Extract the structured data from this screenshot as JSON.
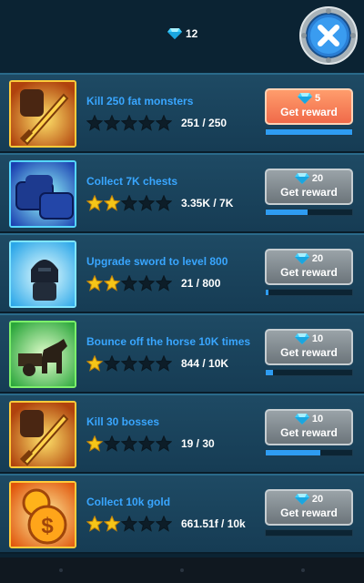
{
  "header": {
    "gem_count": "12"
  },
  "colors": {
    "title": "#39a6ff",
    "bar_fill": "#2e9cf2",
    "star": "#f5c518"
  },
  "quests": [
    {
      "title": "Kill 250 fat monsters",
      "stars_filled": 0,
      "progress": "251 / 250",
      "reward": "5",
      "button_label": "Get reward",
      "highlight": true,
      "bar_fraction": 1.0,
      "icon": "sword-icon"
    },
    {
      "title": "Collect 7K chests",
      "stars_filled": 2,
      "progress": "3.35K / 7K",
      "reward": "20",
      "button_label": "Get reward",
      "highlight": false,
      "bar_fraction": 0.48,
      "icon": "chest-icon"
    },
    {
      "title": "Upgrade sword to level 800",
      "stars_filled": 2,
      "progress": "21 / 800",
      "reward": "20",
      "button_label": "Get reward",
      "highlight": false,
      "bar_fraction": 0.03,
      "icon": "knight-icon"
    },
    {
      "title": "Bounce off the horse 10K times",
      "stars_filled": 1,
      "progress": "844 / 10K",
      "reward": "10",
      "button_label": "Get reward",
      "highlight": false,
      "bar_fraction": 0.08,
      "icon": "horse-cart-icon"
    },
    {
      "title": "Kill 30 bosses",
      "stars_filled": 1,
      "progress": "19 / 30",
      "reward": "10",
      "button_label": "Get reward",
      "highlight": false,
      "bar_fraction": 0.63,
      "icon": "sword-icon"
    },
    {
      "title": "Collect 10k gold",
      "stars_filled": 2,
      "progress": "661.51f / 10k",
      "reward": "20",
      "button_label": "Get reward",
      "highlight": false,
      "bar_fraction": 0.0,
      "icon": "gold-coins-icon"
    }
  ]
}
